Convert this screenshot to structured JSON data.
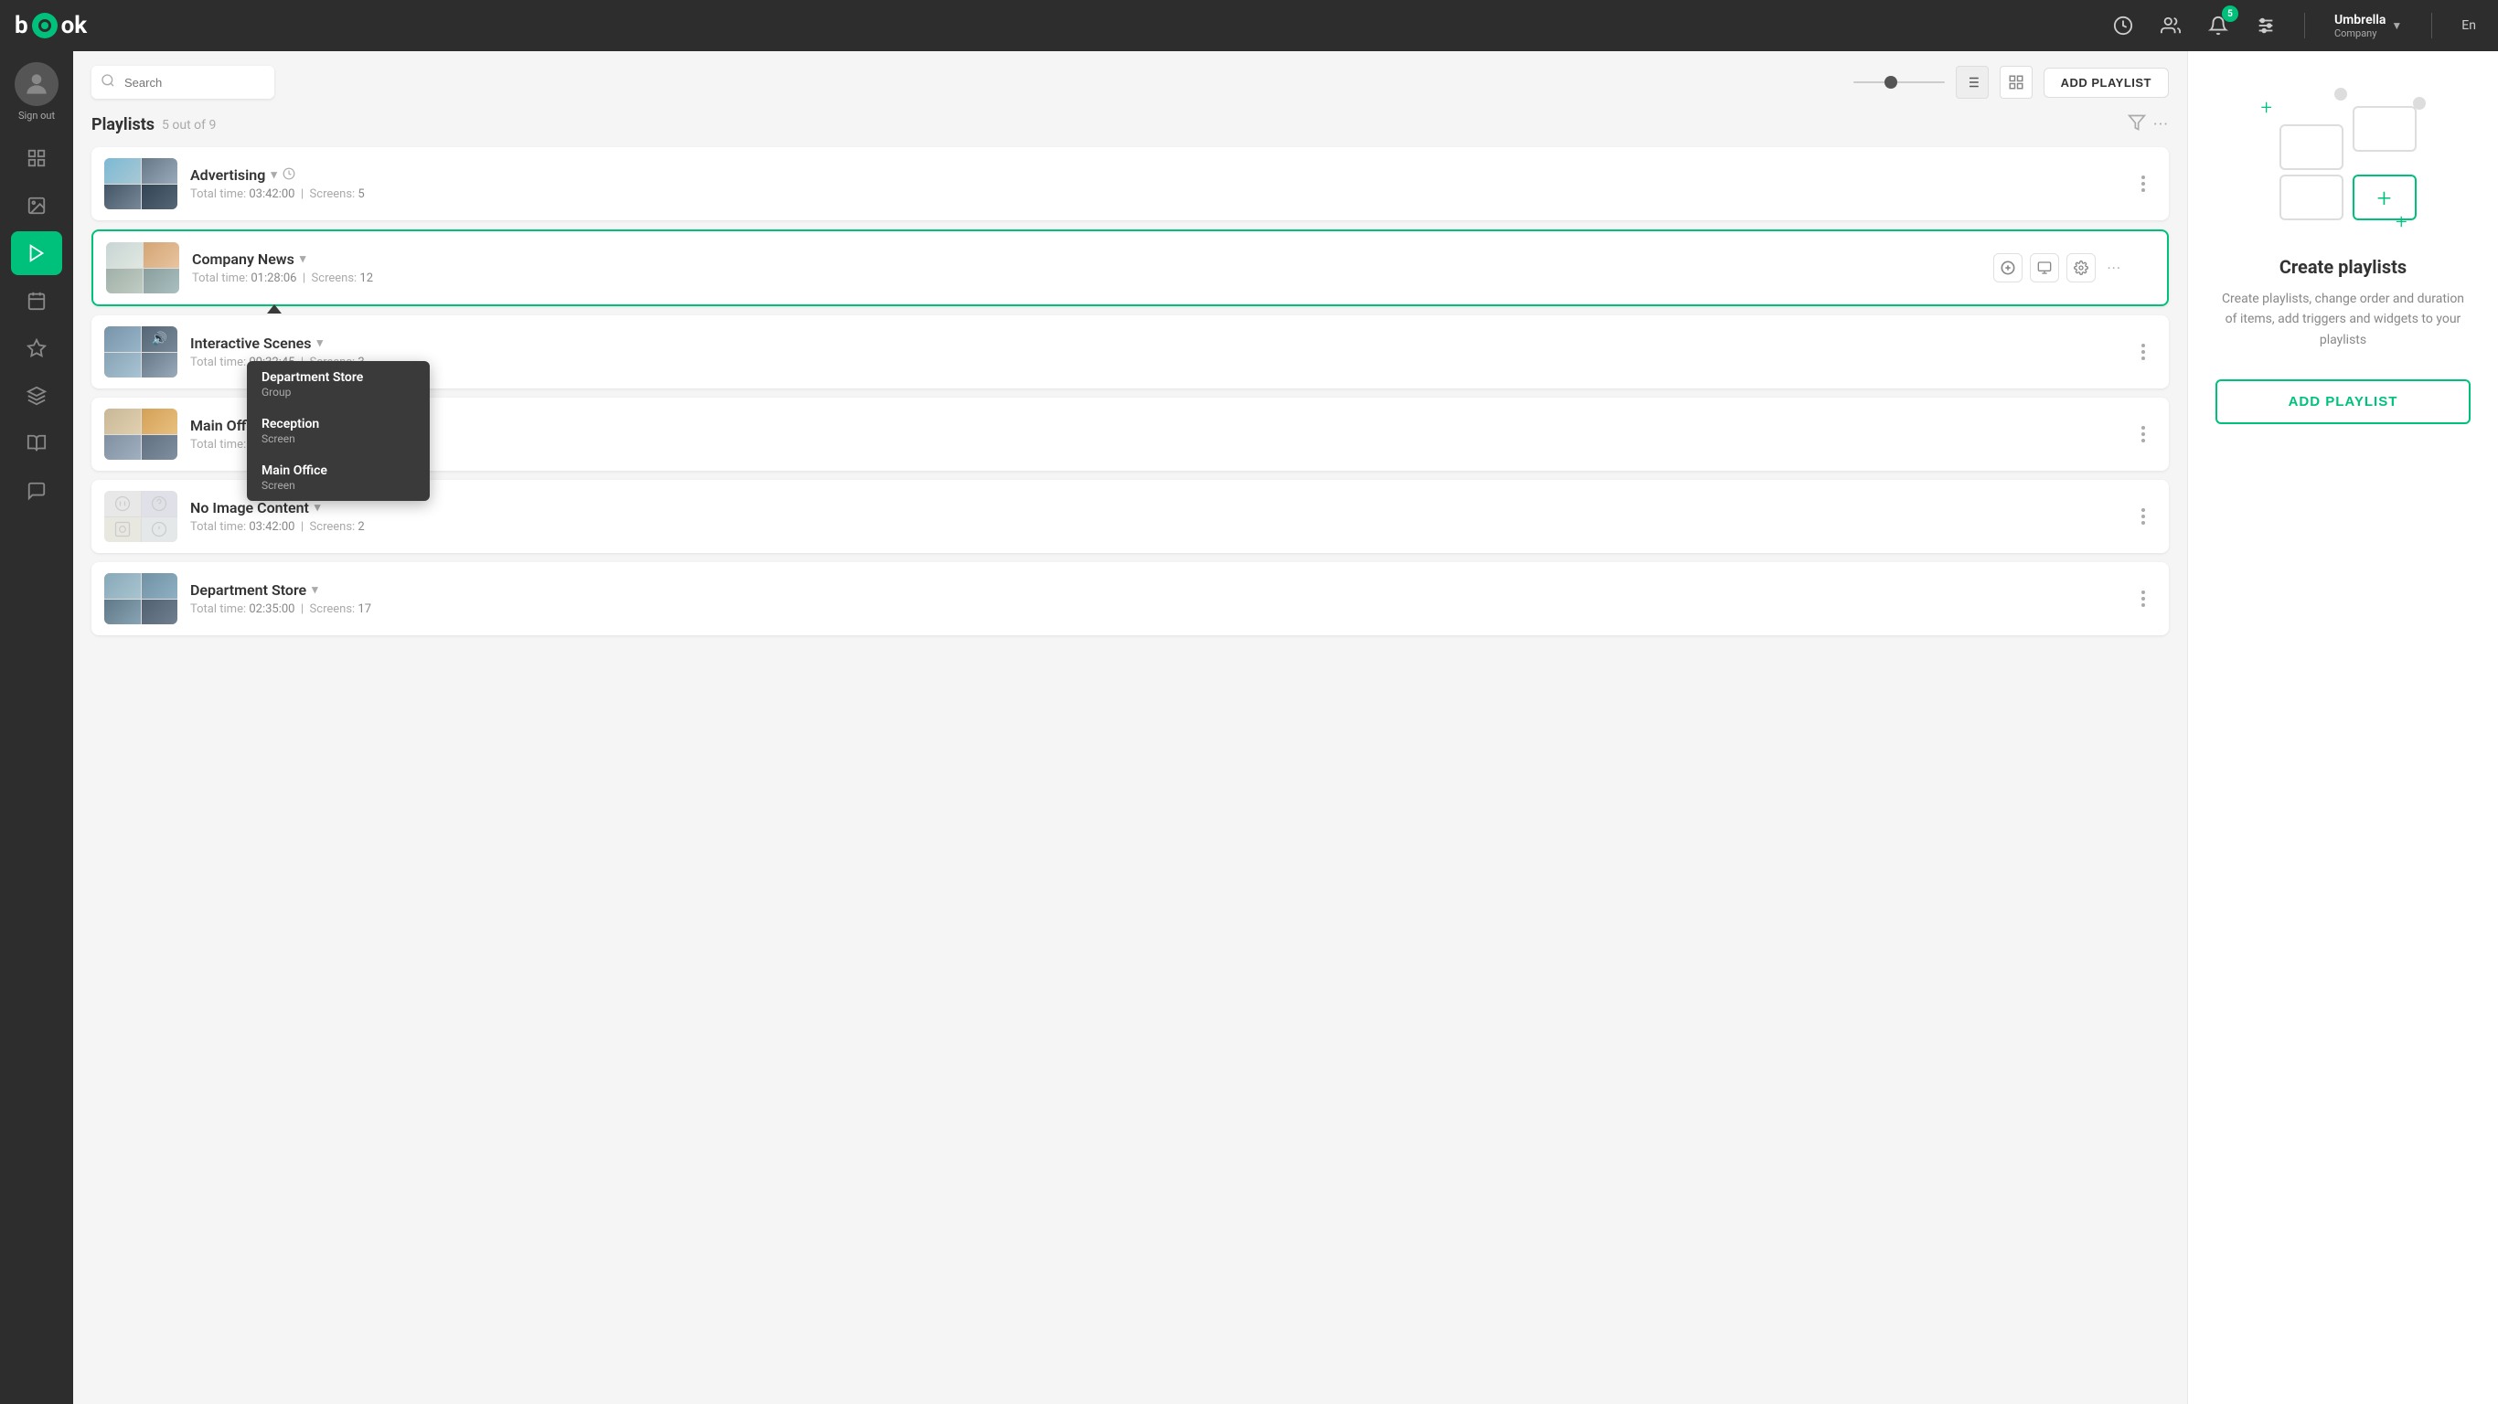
{
  "topnav": {
    "logo_text_left": "b",
    "logo_text_right": "k",
    "notifications_count": "5",
    "company_name": "Umbrella",
    "company_sub": "Company",
    "lang": "En"
  },
  "sidebar": {
    "signout_label": "Sign out",
    "items": [
      {
        "id": "dashboard",
        "icon": "▤"
      },
      {
        "id": "media",
        "icon": "🖼"
      },
      {
        "id": "playlists",
        "icon": "▶",
        "active": true
      },
      {
        "id": "schedule",
        "icon": "📅"
      },
      {
        "id": "templates",
        "icon": "⭐"
      },
      {
        "id": "layers",
        "icon": "◫"
      },
      {
        "id": "books",
        "icon": "📖"
      },
      {
        "id": "messages",
        "icon": "💬"
      }
    ]
  },
  "toolbar": {
    "search_placeholder": "Search",
    "add_playlist_label": "ADD PLAYLIST"
  },
  "playlists": {
    "title": "Playlists",
    "count": "5 out of 9",
    "items": [
      {
        "id": "advertising",
        "name": "Advertising",
        "thumb_class": "thumb-advertising",
        "total_time": "03:42:00",
        "screens": "5",
        "has_clock": true
      },
      {
        "id": "company-news",
        "name": "Company News",
        "thumb_class": "thumb-company",
        "total_time": "01:28:06",
        "screens": "12",
        "has_clock": false,
        "highlighted": true
      },
      {
        "id": "interactive-scenes",
        "name": "Interactive Scenes",
        "thumb_class": "thumb-interactive",
        "total_time": "00:32:45",
        "screens": "3",
        "has_clock": false,
        "has_dropdown": true
      },
      {
        "id": "main-office",
        "name": "Main Office",
        "thumb_class": "thumb-mainoffice",
        "total_time": "00:??:??",
        "screens": "?",
        "has_clock": false
      },
      {
        "id": "no-image-content",
        "name": "No Image Content",
        "thumb_class": "thumb-noimage",
        "total_time": "03:42:00",
        "screens": "2",
        "has_clock": false
      },
      {
        "id": "department-store",
        "name": "Department Store",
        "thumb_class": "thumb-dept",
        "total_time": "02:35:00",
        "screens": "17",
        "has_clock": false
      }
    ]
  },
  "dropdown": {
    "items": [
      {
        "title": "Department Store",
        "subtitle": "Group"
      },
      {
        "title": "Reception",
        "subtitle": "Screen"
      },
      {
        "title": "Main Office",
        "subtitle": "Screen"
      }
    ]
  },
  "right_panel": {
    "title": "Create playlists",
    "description": "Create playlists, change order and duration of items, add triggers and widgets to your playlists",
    "add_btn_label": "ADD PLAYLIST"
  }
}
